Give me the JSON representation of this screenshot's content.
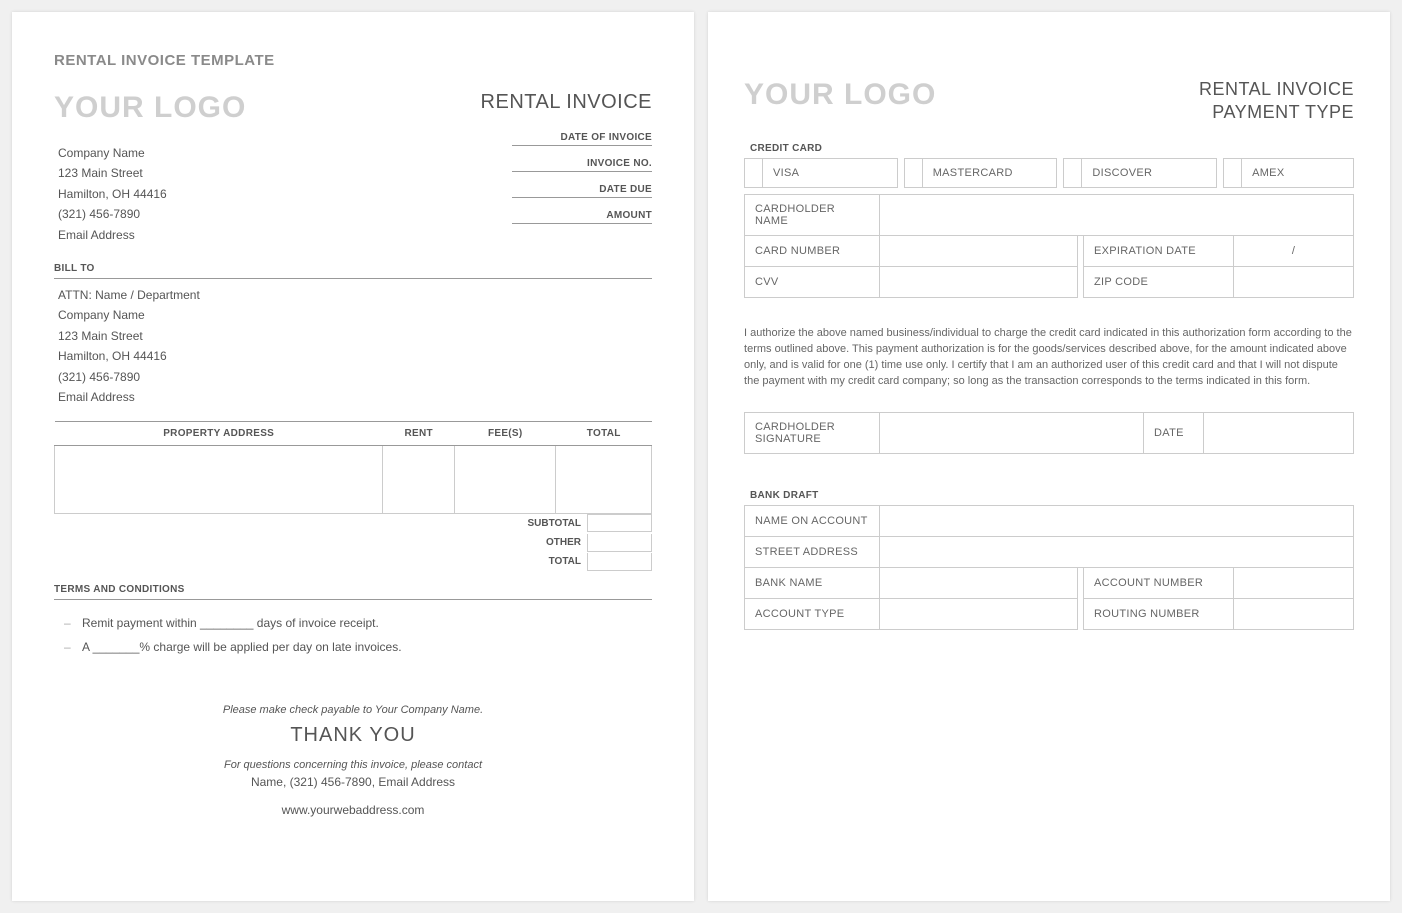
{
  "page1": {
    "template_title": "RENTAL INVOICE TEMPLATE",
    "logo": "YOUR LOGO",
    "doc_title": "RENTAL INVOICE",
    "company": {
      "name": "Company Name",
      "street": "123 Main Street",
      "citystate": "Hamilton, OH  44416",
      "phone": "(321) 456-7890",
      "email": "Email Address"
    },
    "meta": {
      "date_of_invoice": "DATE OF INVOICE",
      "invoice_no": "INVOICE NO.",
      "date_due": "DATE DUE",
      "amount": "AMOUNT"
    },
    "bill_to_label": "BILL TO",
    "bill_to": {
      "attn": "ATTN: Name / Department",
      "name": "Company Name",
      "street": "123 Main Street",
      "citystate": "Hamilton, OH  44416",
      "phone": "(321) 456-7890",
      "email": "Email Address"
    },
    "ledger_heads": {
      "addr": "PROPERTY ADDRESS",
      "rent": "RENT",
      "fees": "FEE(S)",
      "total": "TOTAL"
    },
    "totals": {
      "subtotal": "SUBTOTAL",
      "other": "OTHER",
      "total": "TOTAL"
    },
    "terms_title": "TERMS AND CONDITIONS",
    "terms": [
      "Remit payment within ________ days of invoice receipt.",
      "A _______% charge will be applied per day on late invoices."
    ],
    "footer": {
      "payable": "Please make check payable to Your Company Name.",
      "thanks": "THANK YOU",
      "contact_lead": "For questions concerning this invoice, please contact",
      "contact": "Name, (321) 456-7890, Email Address",
      "web": "www.yourwebaddress.com"
    }
  },
  "page2": {
    "logo": "YOUR LOGO",
    "title_l1": "RENTAL INVOICE",
    "title_l2": "PAYMENT TYPE",
    "credit_card_label": "CREDIT CARD",
    "cc_types": [
      "VISA",
      "MASTERCARD",
      "DISCOVER",
      "AMEX"
    ],
    "cc_fields": {
      "cardholder": "CARDHOLDER NAME",
      "card_number": "CARD NUMBER",
      "exp": "EXPIRATION DATE",
      "exp_val": "/",
      "cvv": "CVV",
      "zip": "ZIP CODE"
    },
    "auth": "I authorize the above named business/individual to charge the credit card indicated in this authorization form according to the terms outlined above. This payment authorization is for the goods/services described above, for the amount indicated above only, and is valid for one (1) time use only. I certify that I am an authorized user of this credit card and that I will not dispute the payment with my credit card company; so long as the transaction corresponds to the terms indicated in this form.",
    "sig": {
      "label": "CARDHOLDER SIGNATURE",
      "date": "DATE"
    },
    "bank_label": "BANK DRAFT",
    "bank": {
      "name_on_account": "NAME ON ACCOUNT",
      "street": "STREET ADDRESS",
      "bank_name": "BANK NAME",
      "account_number": "ACCOUNT NUMBER",
      "account_type": "ACCOUNT TYPE",
      "routing_number": "ROUTING NUMBER"
    }
  }
}
